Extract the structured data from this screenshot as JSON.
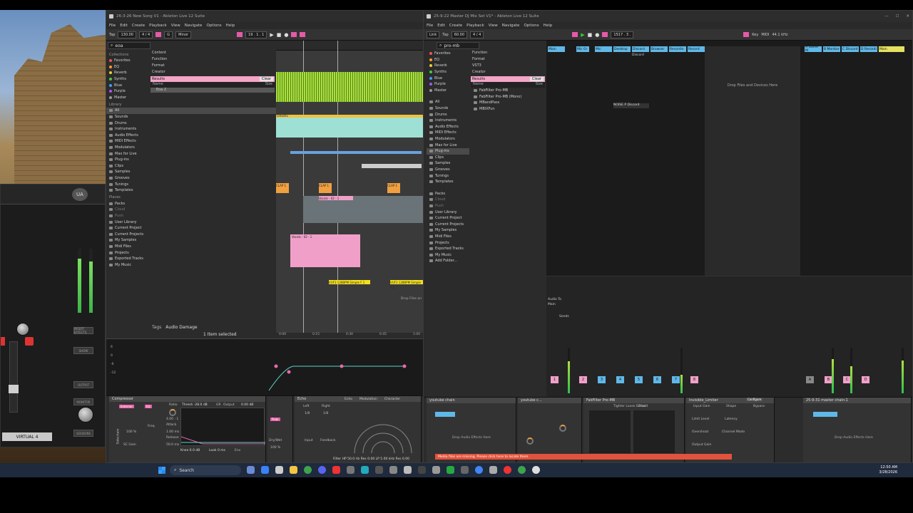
{
  "left_window": {
    "title": "26-3-26 New Song V1 - Ableton Live 12 Suite",
    "menus": [
      "File",
      "Edit",
      "Create",
      "Playback",
      "View",
      "Navigate",
      "Options",
      "Help"
    ],
    "toolbar": {
      "tap": "Tap",
      "tempo": "130.00",
      "meter": "4 / 4",
      "key": "G",
      "scale": "Minor",
      "position": "19 . 1 . 1"
    },
    "browser": {
      "search": "eoa",
      "collections_title": "Collections",
      "collections": [
        "Favorites",
        "EQ",
        "Reverb",
        "Synths",
        "Blue",
        "Purple",
        "Master"
      ],
      "library_title": "Library",
      "library": [
        "All",
        "Sounds",
        "Drums",
        "Instruments",
        "Audio Effects",
        "MIDI Effects",
        "Modulators",
        "Max for Live",
        "Plug-ins",
        "Clips",
        "Samples",
        "Grooves",
        "Tunings",
        "Templates"
      ],
      "places_title": "Places",
      "places": [
        "Packs",
        "Cloud",
        "Push",
        "User Library",
        "Current Project",
        "Current Projects",
        "My Samples",
        "Midi Files",
        "Projects",
        "Exported Tracks",
        "My Music"
      ],
      "filters": [
        "Content",
        "Function",
        "Format",
        "Creator"
      ],
      "results_label": "Results",
      "clear_label": "Clear",
      "name_header": "Name",
      "size_header": "Size",
      "result_file": "Eoa 2",
      "tags_label": "Tags",
      "tag_value": "Audio Damage",
      "status": "1 Item selected"
    },
    "clips": {
      "ghost_label": "Ghostv",
      "clap_label": "CLAP 1",
      "vocals_label": "Vocals - 02 - 1",
      "vuf_label": "VUF3 128BPM Simple F 1",
      "drop_hint": "Drop Files an"
    },
    "time_labels": [
      "0:00",
      "0:15",
      "0:30",
      "0:45",
      "1:00"
    ],
    "automation_ticks": [
      "6",
      "0",
      "-6",
      "-12"
    ],
    "devices": {
      "compressor": {
        "title": "Compressor",
        "sidechain": "Sidechain",
        "external": "External",
        "eq_label": "EQ",
        "thresh": "Thresh -28.0 dB",
        "gr": "GR",
        "output": "Output",
        "out_val": "0.00 dB",
        "ratio": "Ratio",
        "ratio_val": "4.00 : 1",
        "attack": "Attack",
        "attack_val": "1.00 ms",
        "release": "Release",
        "release_val": "50.0 ms",
        "knee": "Knee 6.0 dB",
        "look": "Look 0 ms",
        "env": "Env",
        "mix": "100 %",
        "sc_gain": "SC Gain",
        "freq": "Freq"
      },
      "echo": {
        "title": "Echo",
        "tabs": [
          "Echo",
          "Modulation",
          "Character"
        ],
        "left": "Left",
        "right": "Right",
        "left_val": "1/8",
        "right_val": "1/8",
        "feedback": "Feedback",
        "input": "Input",
        "dry_wet": "Dry/Wet",
        "dry_val": "100 %",
        "filter": "Filter HP 50.0 Hz  Res 0.00  LP 5.00 kHz  Res 0.00"
      }
    }
  },
  "right_window": {
    "title": "25-9-22 Master DJ Mix Set V1* - Ableton Live 12 Suite",
    "menus": [
      "File",
      "Edit",
      "Create",
      "Playback",
      "View",
      "Navigate",
      "Options",
      "Help"
    ],
    "toolbar": {
      "link": "Link",
      "tap": "Tap",
      "tempo": "60.00",
      "meter": "4 / 4",
      "position": "1517 . 3 .",
      "key": "Key",
      "midi": "MIDI",
      "cpu": "44.1 kHz"
    },
    "browser": {
      "search": "pro-mb",
      "collections": [
        "Favorites",
        "EQ",
        "Reverb",
        "Synths",
        "Blue",
        "Purple",
        "Master"
      ],
      "library": [
        "All",
        "Sounds",
        "Drums",
        "Instruments",
        "Audio Effects",
        "MIDI Effects",
        "Modulators",
        "Max for Live",
        "Plug-ins",
        "Clips",
        "Samples",
        "Grooves",
        "Tunings",
        "Templates"
      ],
      "places": [
        "Packs",
        "Cloud",
        "Push",
        "User Library",
        "Current Project",
        "Current Projects",
        "My Samples",
        "Midi Files",
        "Projects",
        "Exported Tracks",
        "My Music",
        "Add Folder..."
      ],
      "filters": [
        "Function",
        "Format",
        "VST3",
        "Creator"
      ],
      "results": [
        "FabFilter Pro-MB",
        "FabFilter Pro-MB (Mono)",
        "MBandPass",
        "MBIXFun"
      ]
    },
    "session": {
      "tracks": [
        "Main",
        "Mic Gr",
        "Mic",
        "Desktop",
        "Discord",
        "Browser",
        "Recordin",
        "Record"
      ],
      "right_tracks": [
        "A Game M",
        "B Monitor",
        "C Discord",
        "D Recordi",
        "Main"
      ],
      "drop_hint": "Drop Files and Devices Here",
      "clip_discord": "Discord",
      "clip_noise": "NOISE P",
      "audio_to": "Audio To",
      "main": "Main",
      "sends": "Sends",
      "track_letters": [
        "1",
        "2",
        "3",
        "4",
        "5",
        "6",
        "7",
        "8",
        "A",
        "B",
        "C",
        "D",
        "M"
      ]
    },
    "devices": {
      "chain1": "youtube chain",
      "chain2": "youtube c...",
      "fabfilter": "FabFilter Pro-MB",
      "invisible": "Invisible_Limiter",
      "master_chain": "25-9-31 master chain-1",
      "drop_effects": "Drop Audio Effects Here",
      "configure": "Configure",
      "input_gain": "Input Gain",
      "shape": "Shape",
      "bypass": "Bypass",
      "limit_level": "Limit Level",
      "latency": "Latency",
      "output_gain": "Output Gain",
      "overshoot": "Overshoot",
      "channel_mode": "Channel Mode",
      "tight_loose": "Tighter Loose - Zeal",
      "default": "Default",
      "none": "none",
      "notice": "Media files are missing. Please click here to locate them."
    }
  },
  "uad": {
    "name": "VIRTUAL 4",
    "labels": [
      "INSERT EFFECTS",
      "SHOW",
      "OUTPUT",
      "MONITOR",
      "SESSIONS"
    ]
  },
  "taskbar": {
    "search_placeholder": "Search",
    "time": "12:50 AM",
    "date": "3/28/2026"
  },
  "colors": {
    "ableton_pink": "#e55aa8",
    "clip_green": "#a8e33a",
    "clip_ghost": "#9ee0d4",
    "clip_orange": "#f0a040",
    "clip_pink": "#f0a0c8",
    "clip_yellow": "#f5e020"
  }
}
